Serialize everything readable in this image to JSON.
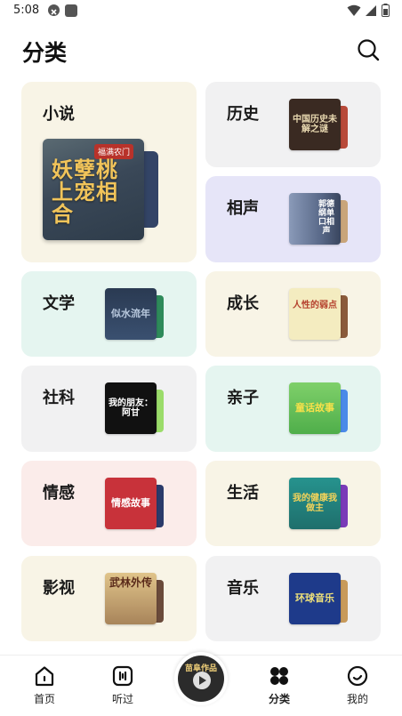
{
  "status_bar": {
    "time": "5:08",
    "icons": [
      "notification-x-icon",
      "notification-square-icon",
      "wifi-icon",
      "signal-icon",
      "battery-icon"
    ]
  },
  "header": {
    "title": "分类",
    "search_icon": "search-icon"
  },
  "categories": [
    {
      "label": "小说",
      "bg": "#f8f4e6",
      "cover_front": {
        "text": "妖孽桃上宠相合",
        "badge": "福满农门",
        "color": "#4a5a6a",
        "accent": "#e9b64a"
      },
      "cover_back_color": "#334466"
    },
    {
      "label": "历史",
      "bg": "#f1f1f2",
      "cover_front": {
        "text": "中国历史未解之谜",
        "color": "#3a2a22",
        "accent": "#e8d8b0"
      },
      "cover_back_color": "#b84a3a"
    },
    {
      "label": "相声",
      "bg": "#e6e5f8",
      "cover_front": {
        "text": "郭德纲单口相声",
        "color": "#5a6a8a",
        "accent": "#ffffff"
      },
      "cover_back_color": "#c9a57a"
    },
    {
      "label": "文学",
      "bg": "#e5f5f0",
      "cover_front": {
        "text": "似水流年",
        "color": "#2a3a52",
        "accent": "#b8c8dd"
      },
      "cover_back_color": "#2e8a5a"
    },
    {
      "label": "成长",
      "bg": "#f8f4e6",
      "cover_front": {
        "text": "人性的弱点",
        "color": "#f4ecc0",
        "accent": "#b5422e"
      },
      "cover_back_color": "#8a5a3a"
    },
    {
      "label": "社科",
      "bg": "#f1f1f2",
      "cover_front": {
        "text": "我的朋友：阿甘",
        "color": "#111111",
        "accent": "#ffffff"
      },
      "cover_back_color": "#9bdc6a"
    },
    {
      "label": "亲子",
      "bg": "#e5f5f0",
      "cover_front": {
        "text": "童话故事",
        "color": "#6cc25a",
        "accent": "#f7e14a"
      },
      "cover_back_color": "#4a8ae8"
    },
    {
      "label": "情感",
      "bg": "#fbecea",
      "cover_front": {
        "text": "情感故事",
        "color": "#c8323a",
        "accent": "#ffffff"
      },
      "cover_back_color": "#2a3a6a"
    },
    {
      "label": "生活",
      "bg": "#f8f4e6",
      "cover_front": {
        "text": "我的健康我做主",
        "color": "#1f7e7a",
        "accent": "#f3d35a"
      },
      "cover_back_color": "#7a3ab8"
    },
    {
      "label": "影视",
      "bg": "#f8f4e6",
      "cover_front": {
        "text": "武林外传",
        "color": "#c8a46a",
        "accent": "#5a2a1a"
      },
      "cover_back_color": "#6a4a3a"
    },
    {
      "label": "音乐",
      "bg": "#f1f1f2",
      "cover_front": {
        "text": "环球音乐",
        "color": "#1e3a8a",
        "accent": "#f1e37a"
      },
      "cover_back_color": "#c89a5a"
    }
  ],
  "tab_bar": {
    "items": [
      {
        "label": "首页",
        "icon": "home-icon"
      },
      {
        "label": "听过",
        "icon": "history-icon"
      },
      {
        "label": "分类",
        "icon": "category-icon",
        "active": true
      },
      {
        "label": "我的",
        "icon": "profile-icon"
      }
    ],
    "center": {
      "badge": "苗阜作品",
      "icon": "play-icon"
    }
  }
}
